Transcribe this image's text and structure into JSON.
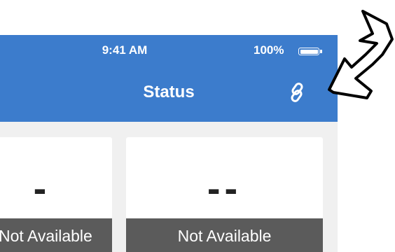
{
  "status_bar": {
    "time": "9:41 AM",
    "battery_percent": "100%",
    "battery_level": 1.0
  },
  "header": {
    "title": "Status",
    "link_icon": "link-icon"
  },
  "cards": [
    {
      "value": "-",
      "status": "Not Available"
    },
    {
      "value": "--",
      "status": "Not Available"
    }
  ],
  "colors": {
    "header_bg": "#3c7ccc",
    "status_bg": "#5b5b5b",
    "page_bg": "#f0f0f0"
  }
}
